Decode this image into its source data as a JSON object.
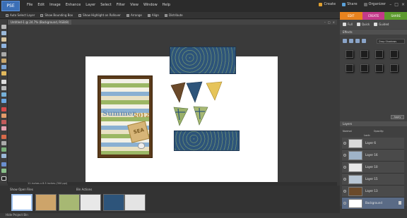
{
  "app": {
    "logo_text": "PSE"
  },
  "menus": [
    "File",
    "Edit",
    "Image",
    "Enhance",
    "Layer",
    "Select",
    "Filter",
    "View",
    "Window",
    "Help"
  ],
  "right_menu": {
    "create": "Create",
    "share": "Share",
    "organizer": "Organizer"
  },
  "options_bar": {
    "auto_select": "Auto Select Layer",
    "bounding_box": "Show Bounding Box",
    "highlight": "Show Highlight on Rollover",
    "arrange": "Arrange",
    "align": "Align",
    "distribute": "Distribute"
  },
  "mode_tabs": {
    "edit": "EDIT",
    "create": "CREATE",
    "share": "SHARE"
  },
  "document": {
    "tab_title": "Untitled-1 @ 24.7% (Background, RGB/8)",
    "status_text": "11 inches x 8.5 inches (300 ppi)",
    "card_title": "Summer",
    "card_year": "2012",
    "card_tag": "SEA"
  },
  "panel": {
    "full": "Full",
    "quick": "Quick",
    "guided": "Guided",
    "effects_title": "Effects",
    "effects_filter": "Drop Shadows",
    "apply": "Apply",
    "layers_title": "Layers",
    "blend_mode": "Normal",
    "opacity_label": "Opacity:",
    "lock_label": "Lock:"
  },
  "layers": [
    {
      "name": "Layer 6"
    },
    {
      "name": "Layer 16"
    },
    {
      "name": "Layer 10"
    },
    {
      "name": "Layer 15"
    },
    {
      "name": "Layer 13"
    },
    {
      "name": "Background"
    }
  ],
  "bin": {
    "show_label": "Show Open Files",
    "actions_label": "Bin Actions",
    "hide_label": "Hide Project Bin"
  }
}
